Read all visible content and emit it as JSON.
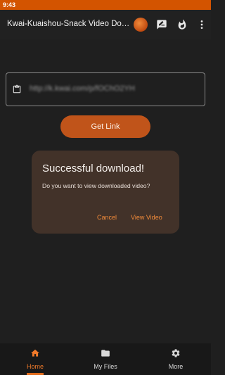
{
  "status_bar": {
    "time": "9:43"
  },
  "app_bar": {
    "title": "Kwai-Kuaishou-Snack Video Dow...",
    "icons": [
      "avatar",
      "feedback-icon",
      "fire-icon",
      "more-vert-icon"
    ]
  },
  "url_field": {
    "value": "http://k.kwai.com/p/fOChO2YH"
  },
  "get_link_button": {
    "label": "Get Link"
  },
  "dialog": {
    "title": "Successful download!",
    "message": "Do you want to view downloaded video?",
    "cancel_label": "Cancel",
    "confirm_label": "View Video"
  },
  "bottom_nav": {
    "items": [
      {
        "label": "Home",
        "icon": "home-icon",
        "active": true
      },
      {
        "label": "My Files",
        "icon": "folder-icon",
        "active": false
      },
      {
        "label": "More",
        "icon": "gear-icon",
        "active": false
      }
    ]
  },
  "colors": {
    "accent": "#d35400",
    "button": "#c0541a",
    "dialog_bg": "#423229",
    "background": "#1f1f1f"
  }
}
